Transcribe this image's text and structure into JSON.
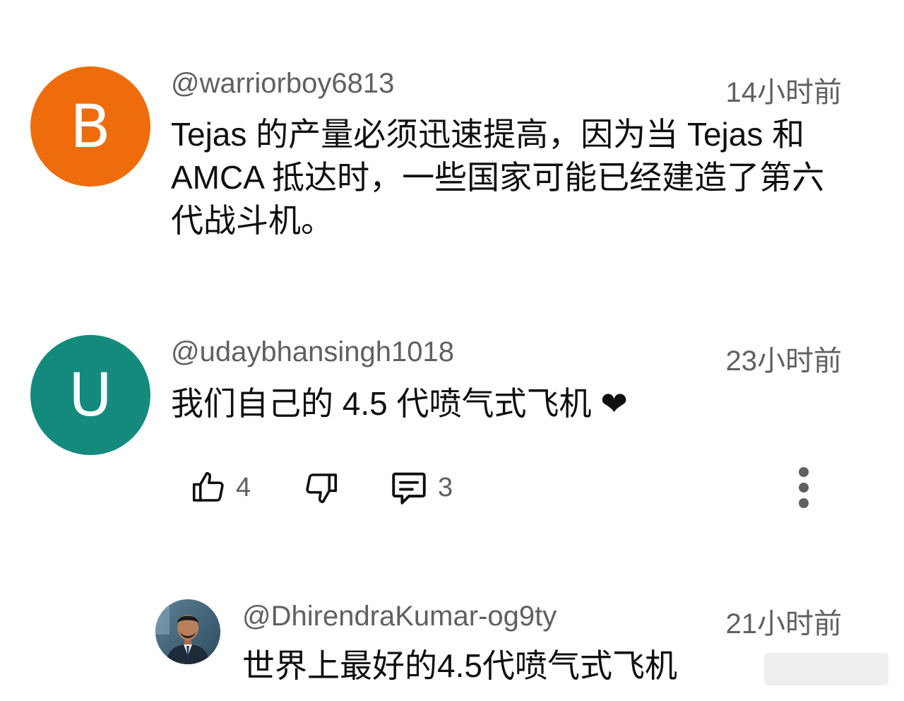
{
  "colors": {
    "avatar_b": "#ee6c0b",
    "avatar_u": "#148a7c",
    "meta_text": "#606060",
    "body_text": "#0f0f0f"
  },
  "comments": [
    {
      "avatar_letter": "B",
      "handle": "@warriorboy6813",
      "time": "14小时前",
      "text": "Tejas 的产量必须迅速提高，因为当 Tejas 和 AMCA 抵达时，一些国家可能已经建造了第六代战斗机。"
    },
    {
      "avatar_letter": "U",
      "handle": "@udaybhansingh1018",
      "time": "23小时前",
      "text": "我们自己的 4.5 代喷气式飞机 ❤",
      "likes": "4",
      "replies": "3",
      "icons": [
        "thumbs-up-icon",
        "thumbs-down-icon",
        "reply-icon",
        "more-options-icon"
      ]
    }
  ],
  "reply": {
    "handle": "@DhirendraKumar-og9ty",
    "time": "21小时前",
    "text": "世界上最好的4.5代喷气式飞机"
  }
}
